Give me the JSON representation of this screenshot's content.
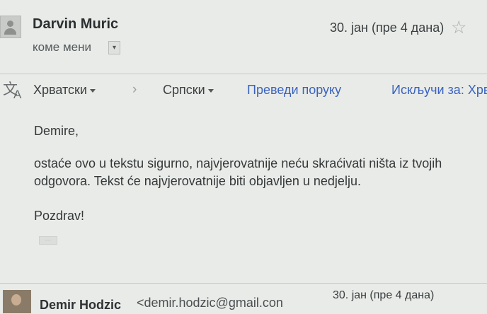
{
  "header": {
    "sender_name": "Darvin Muric",
    "recipient_label": "коме мени",
    "dropdown_glyph": "▾",
    "date": "30. јан (пре 4 дана)",
    "star_icon": "star-icon"
  },
  "translate_bar": {
    "icon": "translate-icon",
    "from_language": "Хрватски",
    "arrow": "›",
    "to_language": "Српски",
    "translate_link": "Преведи поруку",
    "disable_link": "Искључи за: Хрв"
  },
  "body": {
    "greeting": "Demire,",
    "line1": "ostaće ovo u tekstu sigurno, najvjerovatnije neću skraćivati ništa iz tvojih",
    "line2": "odgovora. Tekst će najvjerovatnije biti objavljen u nedjelju.",
    "signoff": "Pozdrav!",
    "ellipsis": "···"
  },
  "next_message": {
    "sender_name": "Demir Hodzic",
    "sender_email": "<demir.hodzic@gmail.con",
    "date": "30. јан (пре 4 дана)"
  },
  "colors": {
    "background": "#e9ebe8",
    "link": "#3a63bf"
  }
}
